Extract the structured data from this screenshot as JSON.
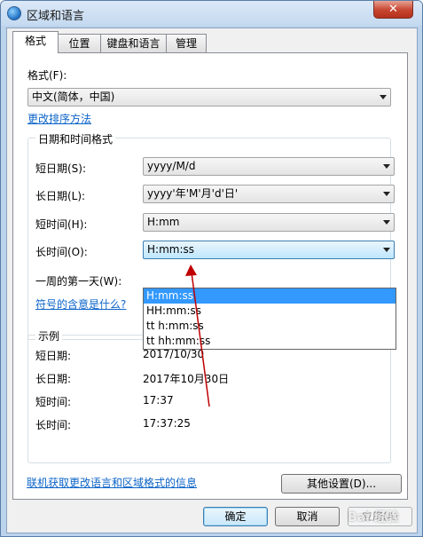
{
  "window": {
    "title": "区域和语言",
    "close_glyph": "✕"
  },
  "tabs": [
    {
      "label": "格式",
      "active": true
    },
    {
      "label": "位置"
    },
    {
      "label": "键盘和语言"
    },
    {
      "label": "管理"
    }
  ],
  "format": {
    "label": "格式(F):",
    "value": "中文(简体，中国)",
    "sort_link": "更改排序方法"
  },
  "datetime": {
    "group_title": "日期和时间格式",
    "short_date": {
      "label": "短日期(S):",
      "value": "yyyy/M/d"
    },
    "long_date": {
      "label": "长日期(L):",
      "value": "yyyy'年'M'月'd'日'"
    },
    "short_time": {
      "label": "短时间(H):",
      "value": "H:mm"
    },
    "long_time": {
      "label": "长时间(O):",
      "value": "H:mm:ss",
      "options": [
        "H:mm:ss",
        "HH:mm:ss",
        "tt h:mm:ss",
        "tt hh:mm:ss"
      ]
    },
    "first_day_label": "一周的第一天(W):",
    "notation_link": "符号的含意是什么?"
  },
  "examples": {
    "group_title": "示例",
    "rows": [
      {
        "label": "短日期:",
        "value": "2017/10/30"
      },
      {
        "label": "长日期:",
        "value": "2017年10月30日"
      },
      {
        "label": "短时间:",
        "value": "17:37"
      },
      {
        "label": "长时间:",
        "value": "17:37:25"
      }
    ]
  },
  "other_settings_button": "其他设置(D)...",
  "online_link": "联机获取更改语言和区域格式的信息",
  "buttons": {
    "ok": "确定",
    "cancel": "取消",
    "apply": "应用(A)"
  },
  "watermark": "Bai 经验",
  "colors": {
    "link": "#0c64c8",
    "selection": "#3399ff",
    "annotation": "#c00000"
  },
  "icons": {
    "app": "globe-icon",
    "dropdown": "chevron-down-icon",
    "close": "close-icon"
  }
}
